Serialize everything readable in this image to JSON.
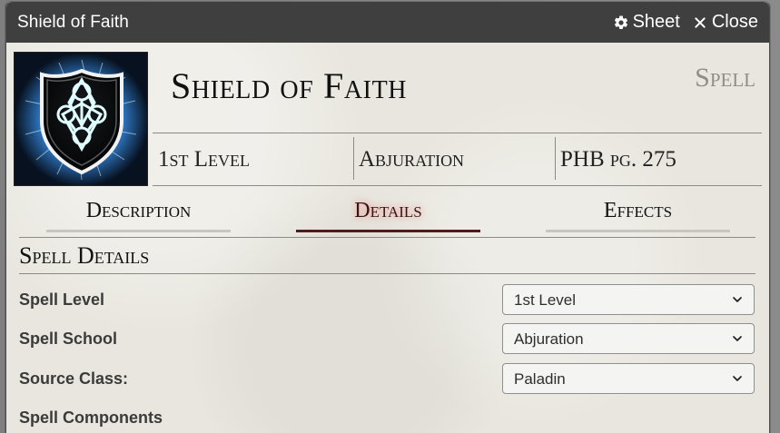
{
  "window": {
    "title": "Shield of Faith",
    "actions": {
      "sheet_label": "Sheet",
      "close_label": "Close"
    }
  },
  "spell": {
    "name": "Shield of Faith",
    "type": "Spell",
    "level": "1st Level",
    "school": "Abjuration",
    "source": "PHB pg. 275",
    "image_icon": "shield-of-faith-art-icon"
  },
  "tabs": [
    {
      "label": "Description"
    },
    {
      "label": "Details"
    },
    {
      "label": "Effects"
    }
  ],
  "details": {
    "section_title": "Spell Details",
    "fields": [
      {
        "label": "Spell Level",
        "value": "1st Level"
      },
      {
        "label": "Spell School",
        "value": "Abjuration"
      },
      {
        "label": "Source Class:",
        "value": "Paladin"
      }
    ],
    "components_label": "Spell Components"
  },
  "icons": {
    "sheet": "gear-icon",
    "close": "close-icon",
    "select": "chevron-down-icon"
  },
  "colors": {
    "titlebar": "#3f3f3f",
    "panel_bg": "#e8e6de",
    "active_tab": "#4d1c1d",
    "divider": "#8c8a85",
    "muted_heading": "#8f8d86"
  }
}
